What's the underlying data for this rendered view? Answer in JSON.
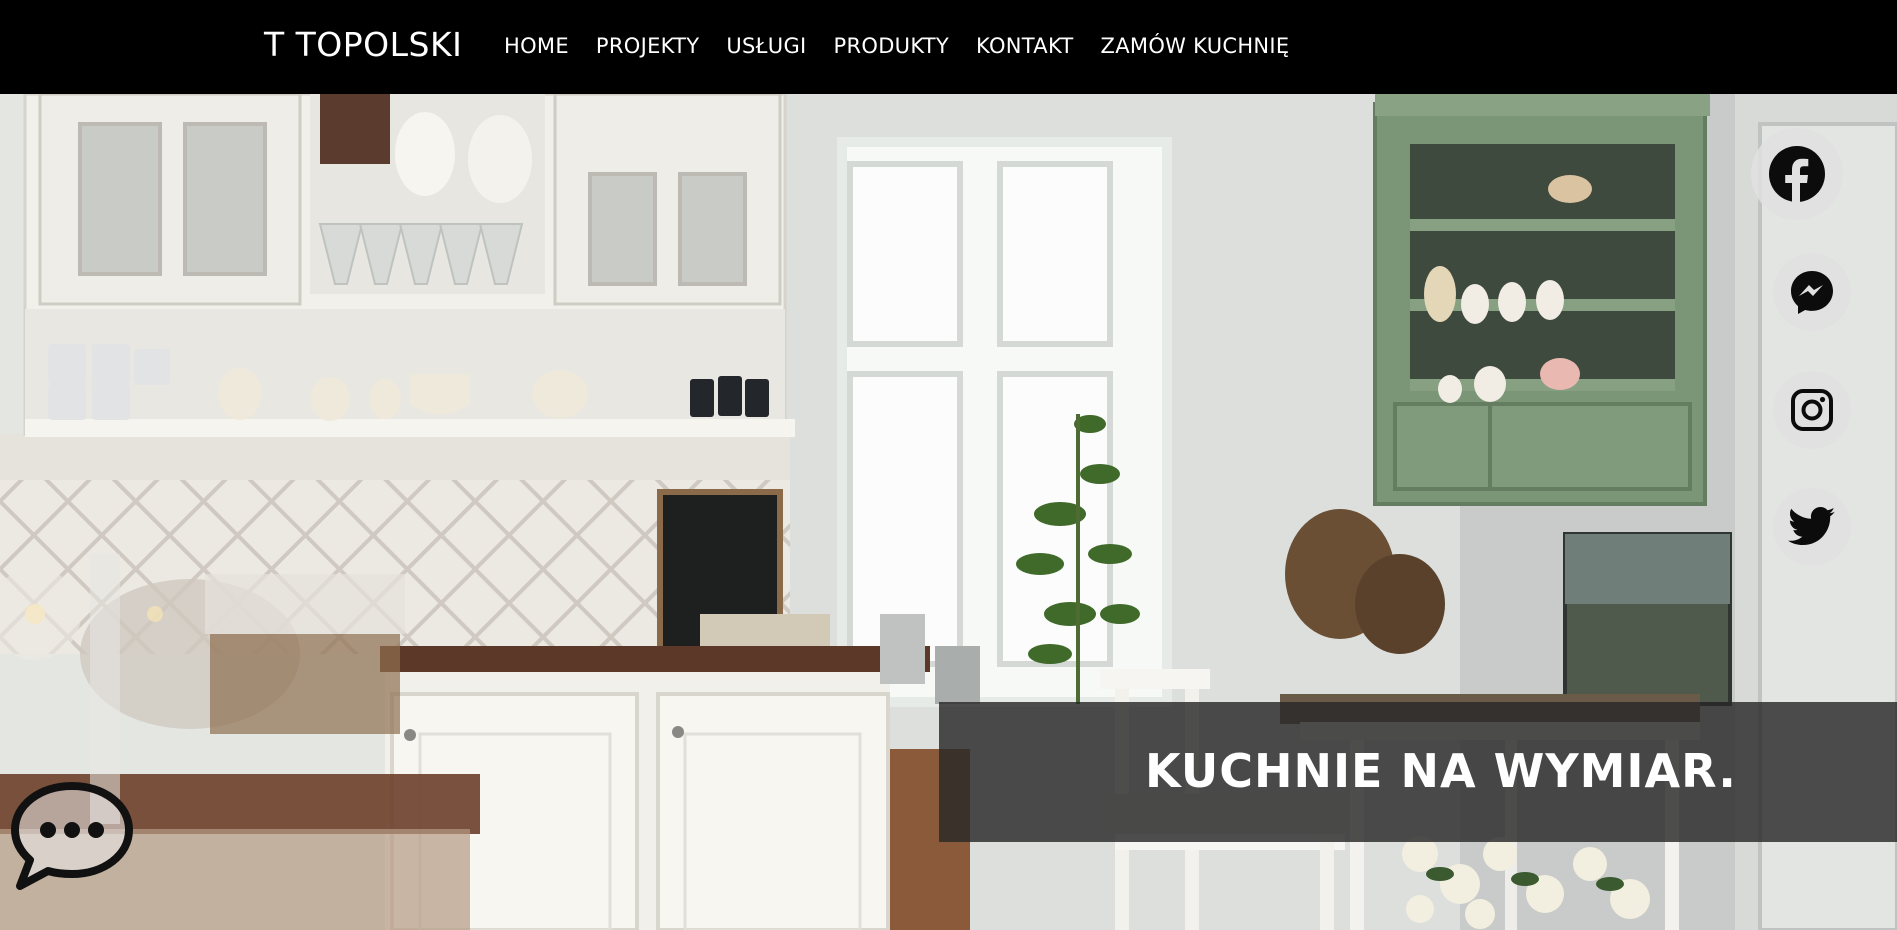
{
  "header": {
    "brand": "T TOPOLSKI",
    "nav": [
      {
        "label": "HOME"
      },
      {
        "label": "PROJEKTY"
      },
      {
        "label": "USŁUGI"
      },
      {
        "label": "PRODUKTY"
      },
      {
        "label": "KONTAKT"
      },
      {
        "label": "ZAMÓW KUCHNIĘ"
      }
    ]
  },
  "hero": {
    "tagline": "KUCHNIE NA WYMIAR.",
    "image": "kitchen-interior-photo"
  },
  "social": [
    {
      "icon": "facebook-icon"
    },
    {
      "icon": "messenger-icon"
    },
    {
      "icon": "instagram-icon"
    },
    {
      "icon": "twitter-icon"
    }
  ],
  "chat": {
    "icon": "chat-bubble-icon"
  },
  "colors": {
    "navbar": "#000000",
    "text": "#ffffff",
    "tagline_bg": "#282828",
    "social_bg": "#e1e1e1",
    "cabinet_green": "#7b9676"
  }
}
